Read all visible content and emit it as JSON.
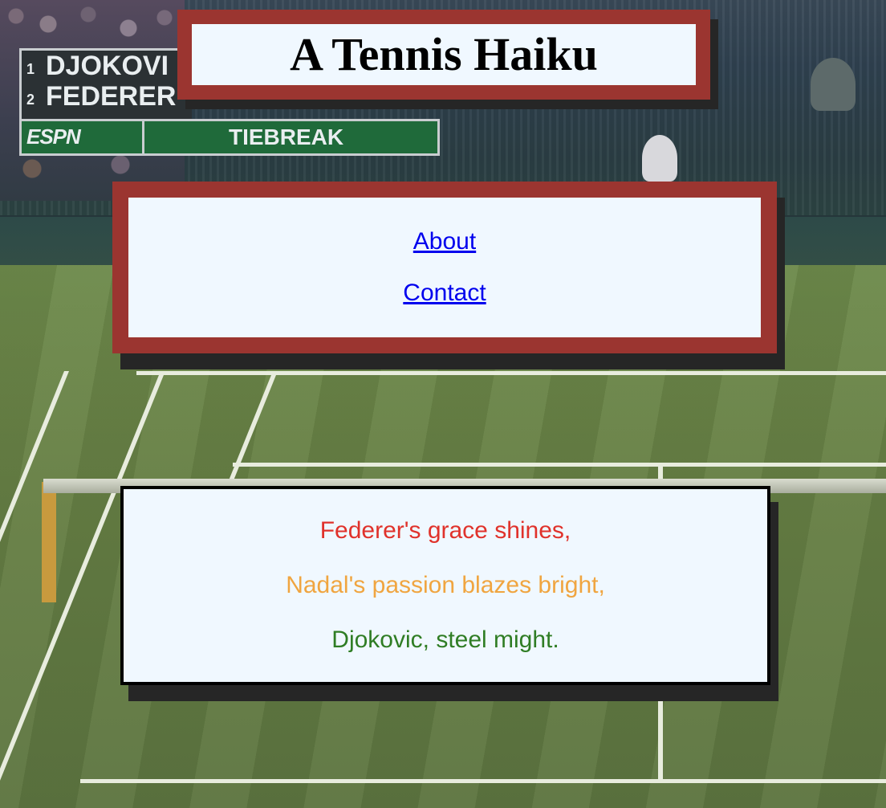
{
  "background": {
    "scoreboard": {
      "players": [
        {
          "seed": "1",
          "name": "DJOKOVI"
        },
        {
          "seed": "2",
          "name": "FEDERER"
        }
      ],
      "network": "ESPN",
      "status": "TIEBREAK"
    }
  },
  "header": {
    "title": "A Tennis Haiku"
  },
  "nav": {
    "links": [
      {
        "label": "About"
      },
      {
        "label": "Contact"
      }
    ]
  },
  "haiku": {
    "lines": [
      {
        "text": "Federer's grace shines,",
        "color": "#e0322b"
      },
      {
        "text": "Nadal's passion blazes bright,",
        "color": "#f0a540"
      },
      {
        "text": "Djokovic, steel might.",
        "color": "#2f7d24"
      }
    ]
  },
  "colors": {
    "frame": "#9b3530",
    "panel": "#f0f8ff",
    "shadow": "#262626",
    "link": "#0000ee"
  }
}
